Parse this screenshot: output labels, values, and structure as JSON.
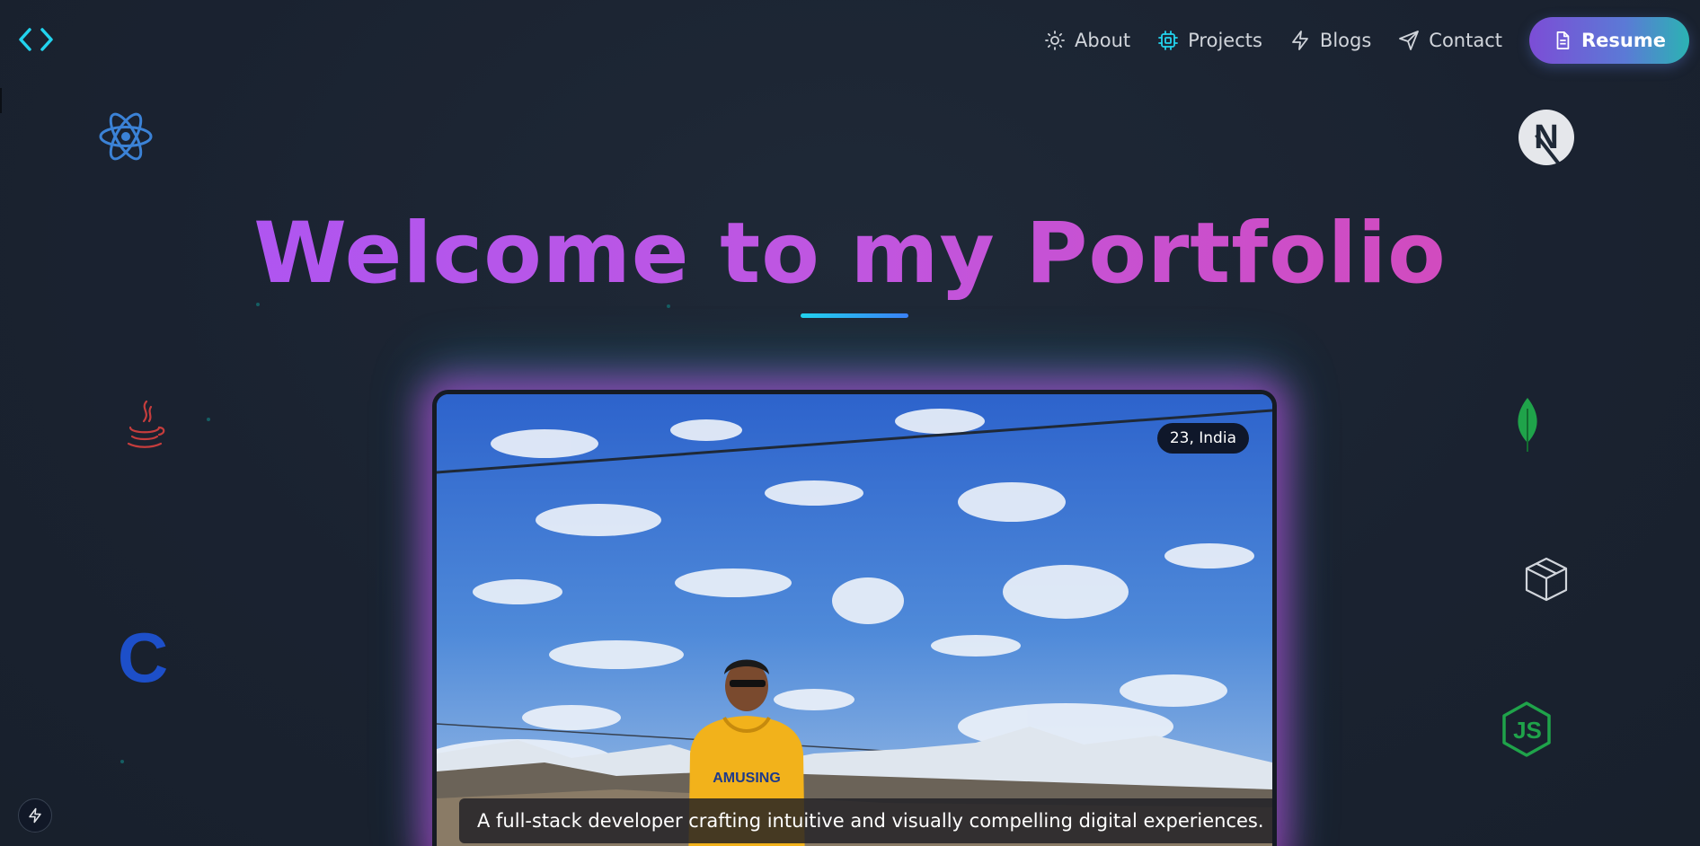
{
  "nav": {
    "items": [
      {
        "label": "About",
        "icon": "sun-icon"
      },
      {
        "label": "Projects",
        "icon": "chip-icon"
      },
      {
        "label": "Blogs",
        "icon": "bolt-icon"
      },
      {
        "label": "Contact",
        "icon": "send-icon"
      }
    ],
    "resume_label": "Resume"
  },
  "hero": {
    "title": "Welcome to my Portfolio"
  },
  "profile": {
    "badge": "23, India",
    "shirt_text": "AMUSING",
    "caption": "A full-stack developer crafting intuitive and visually compelling digital experiences."
  },
  "tech_icons": [
    "react-icon",
    "java-icon",
    "c-language-icon",
    "nextjs-icon",
    "mongodb-icon",
    "npm-package-icon",
    "nodejs-icon"
  ],
  "tech_letters": {
    "c": "C",
    "next": "N",
    "node": "JS"
  },
  "colors": {
    "background": "#1b2330",
    "title_gradient_start": "#a855f7",
    "title_gradient_end": "#d946b0",
    "accent_cyan": "#22d3ee",
    "resume_gradient_start": "#7c4dd6",
    "resume_gradient_end": "#2bb3b3"
  }
}
